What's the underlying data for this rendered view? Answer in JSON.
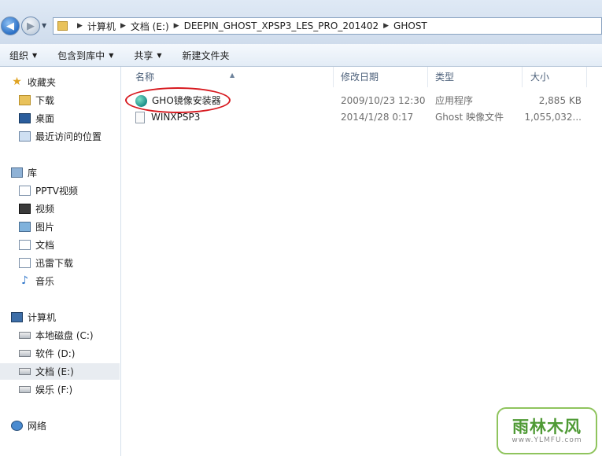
{
  "address_bar": {
    "breadcrumbs": [
      "计算机",
      "文档 (E:)",
      "DEEPIN_GHOST_XPSP3_LES_PRO_201402",
      "GHOST"
    ]
  },
  "command_bar": {
    "organize": "组织",
    "include_in_library": "包含到库中",
    "share": "共享",
    "new_folder": "新建文件夹"
  },
  "nav_pane": {
    "favorites": {
      "label": "收藏夹",
      "items": [
        "下载",
        "桌面",
        "最近访问的位置"
      ]
    },
    "libraries": {
      "label": "库",
      "items": [
        "PPTV视频",
        "视频",
        "图片",
        "文档",
        "迅雷下载",
        "音乐"
      ]
    },
    "computer": {
      "label": "计算机",
      "items": [
        "本地磁盘 (C:)",
        "软件 (D:)",
        "文档 (E:)",
        "娱乐 (F:)"
      ],
      "selected_index": 2
    },
    "network": {
      "label": "网络"
    }
  },
  "file_list": {
    "columns": [
      "名称",
      "修改日期",
      "类型",
      "大小"
    ],
    "rows": [
      {
        "name": "GHO镜像安装器",
        "date": "2009/10/23 12:30",
        "type": "应用程序",
        "size": "2,885 KB"
      },
      {
        "name": "WINXPSP3",
        "date": "2014/1/28 0:17",
        "type": "Ghost 映像文件",
        "size": "1,055,032..."
      }
    ],
    "highlighted_row": 0
  },
  "watermark": {
    "text": "雨林木风",
    "url": "www.YLMFU.com"
  },
  "colors": {
    "highlight_ring": "#d7191f",
    "selected_nav_bg": "#e8ecf1",
    "logo_green": "#4f9a35"
  }
}
